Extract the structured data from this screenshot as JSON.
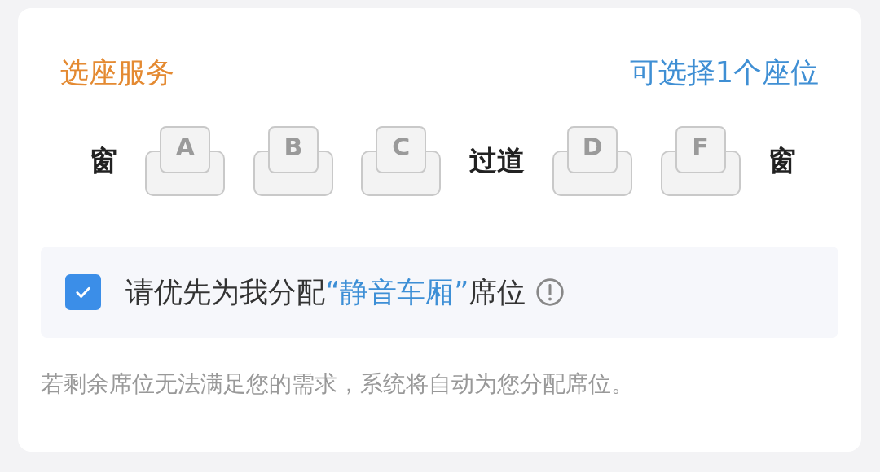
{
  "header": {
    "title": "选座服务",
    "hint": "可选择1个座位"
  },
  "seat_row": [
    {
      "kind": "label",
      "text": "窗"
    },
    {
      "kind": "seat",
      "text": "A",
      "selected": false
    },
    {
      "kind": "seat",
      "text": "B",
      "selected": false
    },
    {
      "kind": "seat",
      "text": "C",
      "selected": false
    },
    {
      "kind": "label",
      "text": "过道"
    },
    {
      "kind": "seat",
      "text": "D",
      "selected": false
    },
    {
      "kind": "seat",
      "text": "F",
      "selected": false
    },
    {
      "kind": "label",
      "text": "窗"
    }
  ],
  "quiet_option": {
    "checked": true,
    "parts": [
      {
        "kind": "plain",
        "text": "请优先为我分配"
      },
      {
        "kind": "link",
        "text": "“静音车厢”"
      },
      {
        "kind": "plain",
        "text": "席位"
      }
    ]
  },
  "note": "若剩余席位无法满足您的需求，系统将自动为您分配席位。"
}
